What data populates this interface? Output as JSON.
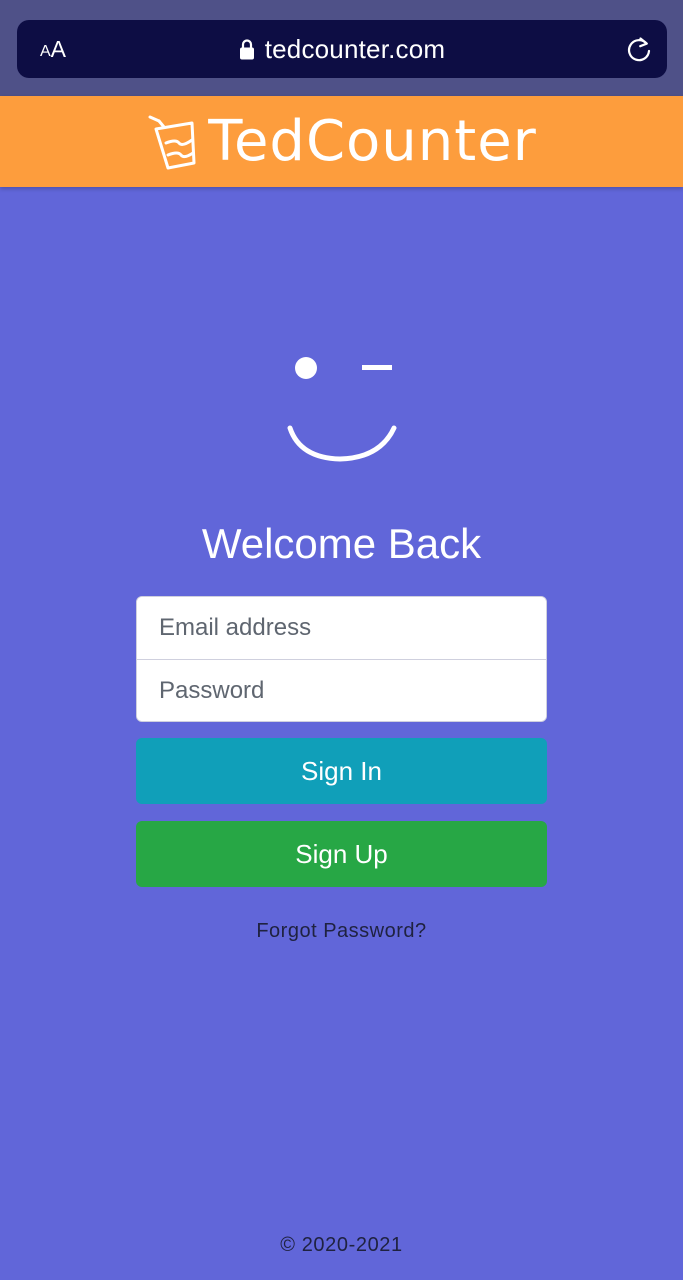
{
  "browser": {
    "text_size_small": "A",
    "text_size_large": "A",
    "url": "tedcounter.com"
  },
  "header": {
    "brand_name": "TedCounter",
    "background_color": "#fd9d3d"
  },
  "login": {
    "title": "Welcome Back",
    "email_placeholder": "Email address",
    "email_value": "",
    "password_placeholder": "Password",
    "password_value": "",
    "sign_in_label": "Sign In",
    "sign_up_label": "Sign Up",
    "forgot_label": "Forgot Password?"
  },
  "footer": {
    "copyright": "© 2020-2021"
  },
  "colors": {
    "page_background": "#6166d9",
    "sign_in": "#109fb9",
    "sign_up": "#27a745"
  }
}
